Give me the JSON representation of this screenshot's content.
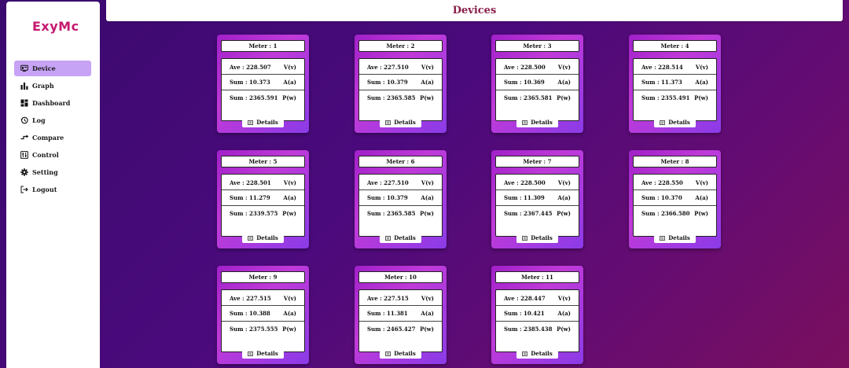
{
  "app": {
    "logo": "ExyMc"
  },
  "sidebar": {
    "items": [
      {
        "label": "Device",
        "icon": "device-icon",
        "active": true
      },
      {
        "label": "Graph",
        "icon": "bar-chart-icon"
      },
      {
        "label": "Dashboard",
        "icon": "dashboard-icon"
      },
      {
        "label": "Log",
        "icon": "history-icon"
      },
      {
        "label": "Compare",
        "icon": "compare-icon"
      },
      {
        "label": "Control",
        "icon": "control-icon"
      },
      {
        "label": "Setting",
        "icon": "gear-icon"
      },
      {
        "label": "Logout",
        "icon": "logout-icon"
      }
    ]
  },
  "header": {
    "title": "Devices"
  },
  "details_label": "Details",
  "meters": [
    {
      "title": "Meter : 1",
      "ave": "Ave : 228.507",
      "sum_a": "Sum : 10.373",
      "sum_p": "Sum : 2365.591",
      "u1": "V(v)",
      "u2": "A(a)",
      "u3": "P(w)"
    },
    {
      "title": "Meter : 2",
      "ave": "Ave : 227.510",
      "sum_a": "Sum : 10.379",
      "sum_p": "Sum : 2365.585",
      "u1": "V(v)",
      "u2": "A(a)",
      "u3": "P(w)"
    },
    {
      "title": "Meter : 3",
      "ave": "Ave : 228.500",
      "sum_a": "Sum : 10.369",
      "sum_p": "Sum : 2365.581",
      "u1": "V(v)",
      "u2": "A(a)",
      "u3": "P(w)"
    },
    {
      "title": "Meter : 4",
      "ave": "Ave : 228.514",
      "sum_a": "Sum : 11.373",
      "sum_p": "Sum : 2355.491",
      "u1": "V(v)",
      "u2": "A(a)",
      "u3": "P(w)"
    },
    {
      "title": "Meter : 5",
      "ave": "Ave : 228.501",
      "sum_a": "Sum : 11.279",
      "sum_p": "Sum : 2339.575",
      "u1": "V(v)",
      "u2": "A(a)",
      "u3": "P(w)"
    },
    {
      "title": "Meter : 6",
      "ave": "Ave : 227.510",
      "sum_a": "Sum : 10.379",
      "sum_p": "Sum : 2365.585",
      "u1": "V(v)",
      "u2": "A(a)",
      "u3": "P(w)"
    },
    {
      "title": "Meter : 7",
      "ave": "Ave : 228.500",
      "sum_a": "Sum : 11.309",
      "sum_p": "Sum : 2367.445",
      "u1": "V(v)",
      "u2": "A(a)",
      "u3": "P(w)"
    },
    {
      "title": "Meter : 8",
      "ave": "Ave : 228.550",
      "sum_a": "Sum : 10.370",
      "sum_p": "Sum : 2366.580",
      "u1": "V(v)",
      "u2": "A(a)",
      "u3": "P(w)"
    },
    {
      "title": "Meter : 9",
      "ave": "Ave : 227.515",
      "sum_a": "Sum : 10.388",
      "sum_p": "Sum : 2375.555",
      "u1": "V(v)",
      "u2": "A(a)",
      "u3": "P(w)"
    },
    {
      "title": "Meter : 10",
      "ave": "Ave : 227.515",
      "sum_a": "Sum : 11.381",
      "sum_p": "Sum : 2465.427",
      "u1": "V(v)",
      "u2": "A(a)",
      "u3": "P(w)"
    },
    {
      "title": "Meter : 11",
      "ave": "Ave : 228.447",
      "sum_a": "Sum : 10.421",
      "sum_p": "Sum : 2385.438",
      "u1": "V(v)",
      "u2": "A(a)",
      "u3": "P(w)"
    }
  ]
}
